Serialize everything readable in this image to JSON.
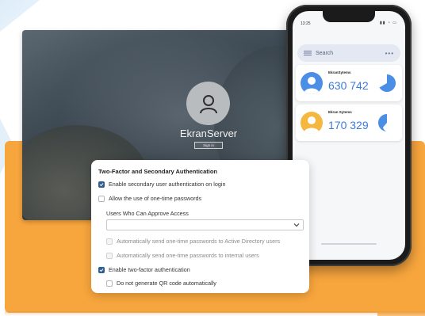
{
  "login": {
    "server_name": "EkranServer",
    "signin_label": "Sign in"
  },
  "phone": {
    "status_time": "13:25",
    "search_placeholder": "Search",
    "menu_dots": "•••",
    "cards": [
      {
        "name": "EkranSytems",
        "value": "630 742",
        "avatar_color": "#4a8ee6",
        "pie_color": "#4a8ee6"
      },
      {
        "name": "Ekran Sytems",
        "value": "170 329",
        "avatar_color": "#f5b740",
        "pie_color": "#4a8ee6"
      }
    ]
  },
  "dialog": {
    "title": "Two-Factor and Secondary Authentication",
    "options": [
      {
        "label": "Enable secondary user authentication on login",
        "checked": true,
        "disabled": false
      },
      {
        "label": "Allow the use of one-time passwords",
        "checked": false,
        "disabled": false
      },
      {
        "label": "Automatically send one-time passwords to Active Directory users",
        "checked": false,
        "disabled": true
      },
      {
        "label": "Automatically send one-time passwords to internal users",
        "checked": false,
        "disabled": true
      },
      {
        "label": "Enable two-factor authentication",
        "checked": true,
        "disabled": false
      },
      {
        "label": "Do not generate QR code automatically",
        "checked": false,
        "disabled": false
      }
    ],
    "approvers_label": "Users Who Can Approve Access",
    "approvers_value": ""
  },
  "colors": {
    "accent_orange": "#f7a53d",
    "checkbox_checked": "#2f5d8f",
    "phone_number": "#3d7bd8"
  }
}
